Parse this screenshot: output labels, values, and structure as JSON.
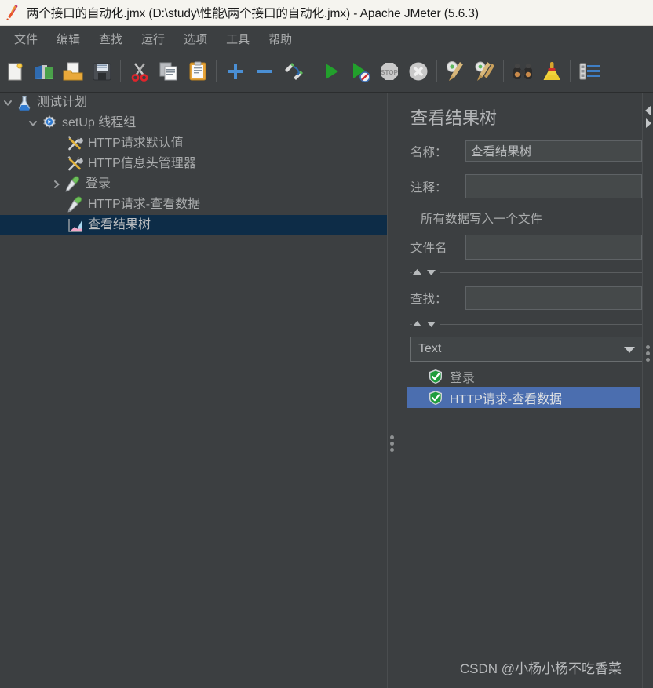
{
  "window": {
    "title": "两个接口的自动化.jmx (D:\\study\\性能\\两个接口的自动化.jmx) - Apache JMeter (5.6.3)",
    "app_icon": "jmeter-feather-icon"
  },
  "menubar": {
    "items": [
      {
        "label": "文件",
        "name": "menu-file"
      },
      {
        "label": "编辑",
        "name": "menu-edit"
      },
      {
        "label": "查找",
        "name": "menu-search"
      },
      {
        "label": "运行",
        "name": "menu-run"
      },
      {
        "label": "选项",
        "name": "menu-options"
      },
      {
        "label": "工具",
        "name": "menu-tools"
      },
      {
        "label": "帮助",
        "name": "menu-help"
      }
    ]
  },
  "toolbar": {
    "buttons": [
      {
        "icon": "new-document-icon",
        "name": "toolbar-new"
      },
      {
        "icon": "templates-icon",
        "name": "toolbar-templates"
      },
      {
        "icon": "open-folder-icon",
        "name": "toolbar-open"
      },
      {
        "icon": "save-floppy-icon",
        "name": "toolbar-save"
      },
      {
        "icon": "cut-scissors-icon",
        "name": "toolbar-cut"
      },
      {
        "icon": "copy-pages-icon",
        "name": "toolbar-copy"
      },
      {
        "icon": "paste-clipboard-icon",
        "name": "toolbar-paste"
      },
      {
        "icon": "plus-icon",
        "name": "toolbar-expand-all"
      },
      {
        "icon": "minus-icon",
        "name": "toolbar-collapse-all"
      },
      {
        "icon": "toggle-pencil-icon",
        "name": "toolbar-toggle"
      },
      {
        "icon": "start-play-icon",
        "name": "toolbar-start"
      },
      {
        "icon": "start-no-pauses-icon",
        "name": "toolbar-start-no-timers"
      },
      {
        "icon": "stop-icon",
        "name": "toolbar-stop"
      },
      {
        "icon": "shutdown-icon",
        "name": "toolbar-shutdown"
      },
      {
        "icon": "clear-gear-broom-icon",
        "name": "toolbar-clear"
      },
      {
        "icon": "clear-all-gear-broom-icon",
        "name": "toolbar-clear-all"
      },
      {
        "icon": "binoculars-search-icon",
        "name": "toolbar-search"
      },
      {
        "icon": "reset-broom-icon",
        "name": "toolbar-reset-search"
      },
      {
        "icon": "function-helper-icon",
        "name": "toolbar-function-helper"
      }
    ]
  },
  "tree": {
    "nodes": [
      {
        "label": "测试计划",
        "icon": "flask-icon",
        "depth": 0,
        "twisty": "expanded",
        "selected": false,
        "name": "tree-node-test-plan"
      },
      {
        "label": "setUp 线程组",
        "icon": "gear-thread-group-icon",
        "depth": 1,
        "twisty": "expanded",
        "selected": false,
        "name": "tree-node-setup-thread-group"
      },
      {
        "label": "HTTP请求默认值",
        "icon": "config-tools-icon",
        "depth": 2,
        "twisty": "none",
        "selected": false,
        "name": "tree-node-http-request-defaults"
      },
      {
        "label": "HTTP信息头管理器",
        "icon": "config-tools-icon",
        "depth": 2,
        "twisty": "none",
        "selected": false,
        "name": "tree-node-http-header-manager"
      },
      {
        "label": "登录",
        "icon": "sampler-pipette-icon",
        "depth": 2,
        "twisty": "collapsed",
        "selected": false,
        "name": "tree-node-login"
      },
      {
        "label": "HTTP请求-查看数据",
        "icon": "sampler-pipette-icon",
        "depth": 2,
        "twisty": "none",
        "selected": false,
        "name": "tree-node-http-request-view-data"
      },
      {
        "label": "查看结果树",
        "icon": "view-results-tree-icon",
        "depth": 2,
        "twisty": "none",
        "selected": true,
        "name": "tree-node-view-results-tree"
      }
    ]
  },
  "editor": {
    "title": "查看结果树",
    "name_label": "名称：",
    "name_value": "查看结果树",
    "comment_label": "注释：",
    "comment_value": "",
    "group_title": "所有数据写入一个文件",
    "filename_label": "文件名",
    "filename_value": "",
    "search_label": "查找：",
    "search_value": "",
    "renderer_selected": "Text",
    "renderer_arrow": "chevron-down-icon",
    "results": [
      {
        "label": "登录",
        "icon": "success-shield-icon",
        "selected": false,
        "name": "result-item-login"
      },
      {
        "label": "HTTP请求-查看数据",
        "icon": "success-shield-icon",
        "selected": true,
        "name": "result-item-http-request-view-data"
      }
    ]
  },
  "watermark": "CSDN @小杨小杨不吃香菜",
  "colors": {
    "window_bg": "#3c3f41",
    "titlebar_bg": "#f5f4ef",
    "tree_selection": "#0d2c47",
    "list_selection": "#4b6eaf",
    "text": "#a9abac",
    "field_bg": "#45494a"
  }
}
